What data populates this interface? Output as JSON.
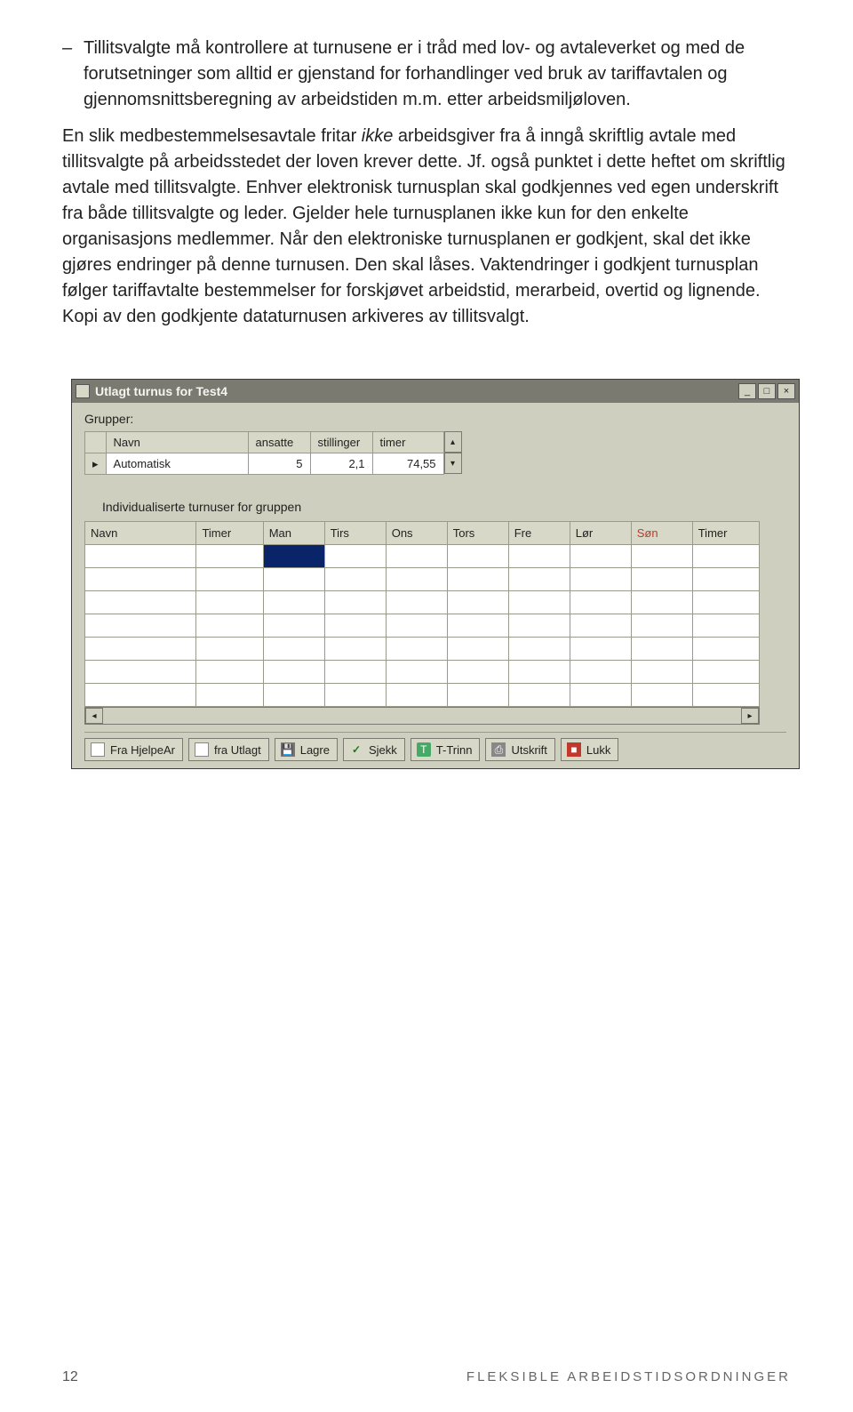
{
  "bullet": {
    "text": "Tillitsvalgte må kontrollere at turnusene er i tråd med lov- og avtaleverket og med de forutsetninger som alltid er gjenstand for forhandlinger ved bruk av tariffavtalen og gjennomsnittsberegning av arbeidstiden m.m. etter arbeidsmiljøloven."
  },
  "para1_a": "En slik medbestemmelsesavtale fritar ",
  "para1_italic": "ikke",
  "para1_b": " arbeidsgiver fra å inngå skriftlig avtale med tillitsvalgte på arbeidsstedet der loven krever dette. Jf. også punktet i dette heftet om skriftlig avtale med tillitsvalgte. Enhver elektronisk turnusplan skal godkjennes ved egen underskrift fra både tillitsvalgte og leder. Gjelder hele turnusplanen ikke kun for den enkelte organisasjons medlemmer. Når den elektroniske turnusplanen er godkjent, skal det ikke gjøres endringer på denne turnusen. Den skal låses. Vaktendringer i godkjent turnusplan følger tariffavtalte bestemmelser for forskjøvet arbeidstid, merarbeid, overtid og lignende. Kopi av den godkjente dataturnusen arkiveres av tillitsvalgt.",
  "window": {
    "title": "Utlagt turnus for Test4",
    "grupper_label": "Grupper:",
    "top_headers": [
      "Navn",
      "ansatte",
      "stillinger",
      "timer"
    ],
    "top_row": {
      "name": "Automatisk",
      "ansatte": "5",
      "stillinger": "2,1",
      "timer": "74,55"
    },
    "mid_label": "Individualiserte turnuser for gruppen",
    "bottom_headers": [
      "Navn",
      "Timer",
      "Man",
      "Tirs",
      "Ons",
      "Tors",
      "Fre",
      "Lør",
      "Søn",
      "Timer"
    ],
    "toolbar": {
      "fra_hjelpe": "Fra HjelpeAr",
      "fra_utlagt": "fra Utlagt",
      "lagre": "Lagre",
      "sjekk": "Sjekk",
      "ttrinn": "T-Trinn",
      "utskrift": "Utskrift",
      "lukk": "Lukk"
    }
  },
  "footer": {
    "page": "12",
    "title": "FLEKSIBLE ARBEIDSTIDSORDNINGER"
  }
}
